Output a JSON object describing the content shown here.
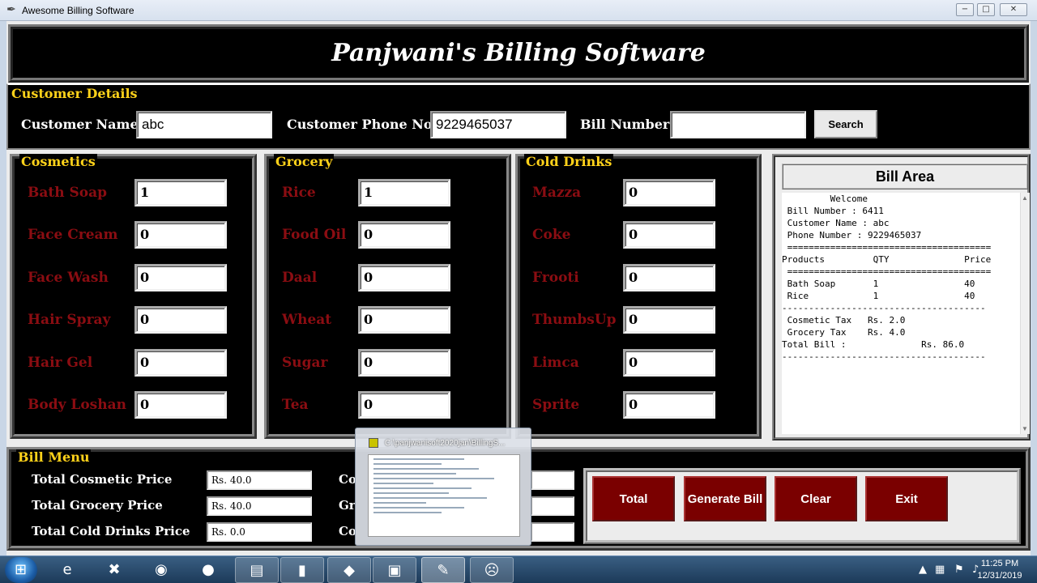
{
  "window": {
    "title": "Awesome Billing Software",
    "minimize": "−",
    "maximize": "□",
    "close": "✕"
  },
  "header": {
    "title": "Panjwani's Billing Software"
  },
  "customer": {
    "section_label": "Customer Details",
    "name_label": "Customer Name",
    "name_value": "abc",
    "phone_label": "Customer Phone No.",
    "phone_value": "9229465037",
    "bill_label": "Bill Number",
    "bill_value": "",
    "search_label": "Search"
  },
  "cosmetics": {
    "label": "Cosmetics",
    "items": [
      {
        "name": "Bath Soap",
        "qty": "1"
      },
      {
        "name": "Face Cream",
        "qty": "0"
      },
      {
        "name": "Face Wash",
        "qty": "0"
      },
      {
        "name": "Hair Spray",
        "qty": "0"
      },
      {
        "name": "Hair Gel",
        "qty": "0"
      },
      {
        "name": "Body Loshan",
        "qty": "0"
      }
    ]
  },
  "grocery": {
    "label": "Grocery",
    "items": [
      {
        "name": "Rice",
        "qty": "1"
      },
      {
        "name": "Food Oil",
        "qty": "0"
      },
      {
        "name": "Daal",
        "qty": "0"
      },
      {
        "name": "Wheat",
        "qty": "0"
      },
      {
        "name": "Sugar",
        "qty": "0"
      },
      {
        "name": "Tea",
        "qty": "0"
      }
    ]
  },
  "drinks": {
    "label": "Cold Drinks",
    "items": [
      {
        "name": "Mazza",
        "qty": "0"
      },
      {
        "name": "Coke",
        "qty": "0"
      },
      {
        "name": "Frooti",
        "qty": "0"
      },
      {
        "name": "ThumbsUp",
        "qty": "0"
      },
      {
        "name": "Limca",
        "qty": "0"
      },
      {
        "name": "Sprite",
        "qty": "0"
      }
    ]
  },
  "bill_area": {
    "title": "Bill Area",
    "lines": [
      "         Welcome",
      " Bill Number : 6411",
      " Customer Name : abc",
      " Phone Number : 9229465037",
      " ======================================",
      "Products         QTY              Price",
      " ======================================",
      " Bath Soap       1                40",
      " Rice            1                40",
      "--------------------------------------",
      " Cosmetic Tax   Rs. 2.0",
      " Grocery Tax    Rs. 4.0",
      "Total Bill :              Rs. 86.0",
      "--------------------------------------"
    ]
  },
  "bill_menu": {
    "label": "Bill Menu",
    "cosmetic_label": "Total Cosmetic Price",
    "cosmetic_value": "Rs. 40.0",
    "grocery_label": "Total Grocery Price",
    "grocery_value": "Rs. 40.0",
    "drinks_label": "Total Cold Drinks Price",
    "drinks_value": "Rs. 0.0",
    "tax1_label": "Co",
    "tax2_label": "Gr",
    "tax3_label": "Co"
  },
  "buttons": {
    "total": "Total",
    "generate": "Generate Bill",
    "clear": "Clear",
    "exit": "Exit"
  },
  "thumbnail": {
    "title": "C:\\panjwanisoft2020jan\\BillingS..."
  },
  "taskbar": {
    "time": "11:25 PM",
    "date": "12/31/2019",
    "apps": [
      "ie-icon",
      "xampp-icon",
      "chrome-icon",
      "firefox-icon",
      "folder-icon",
      "cmd-icon",
      "app-icon",
      "explorer-icon",
      "notepad-icon",
      "python-icon"
    ]
  }
}
